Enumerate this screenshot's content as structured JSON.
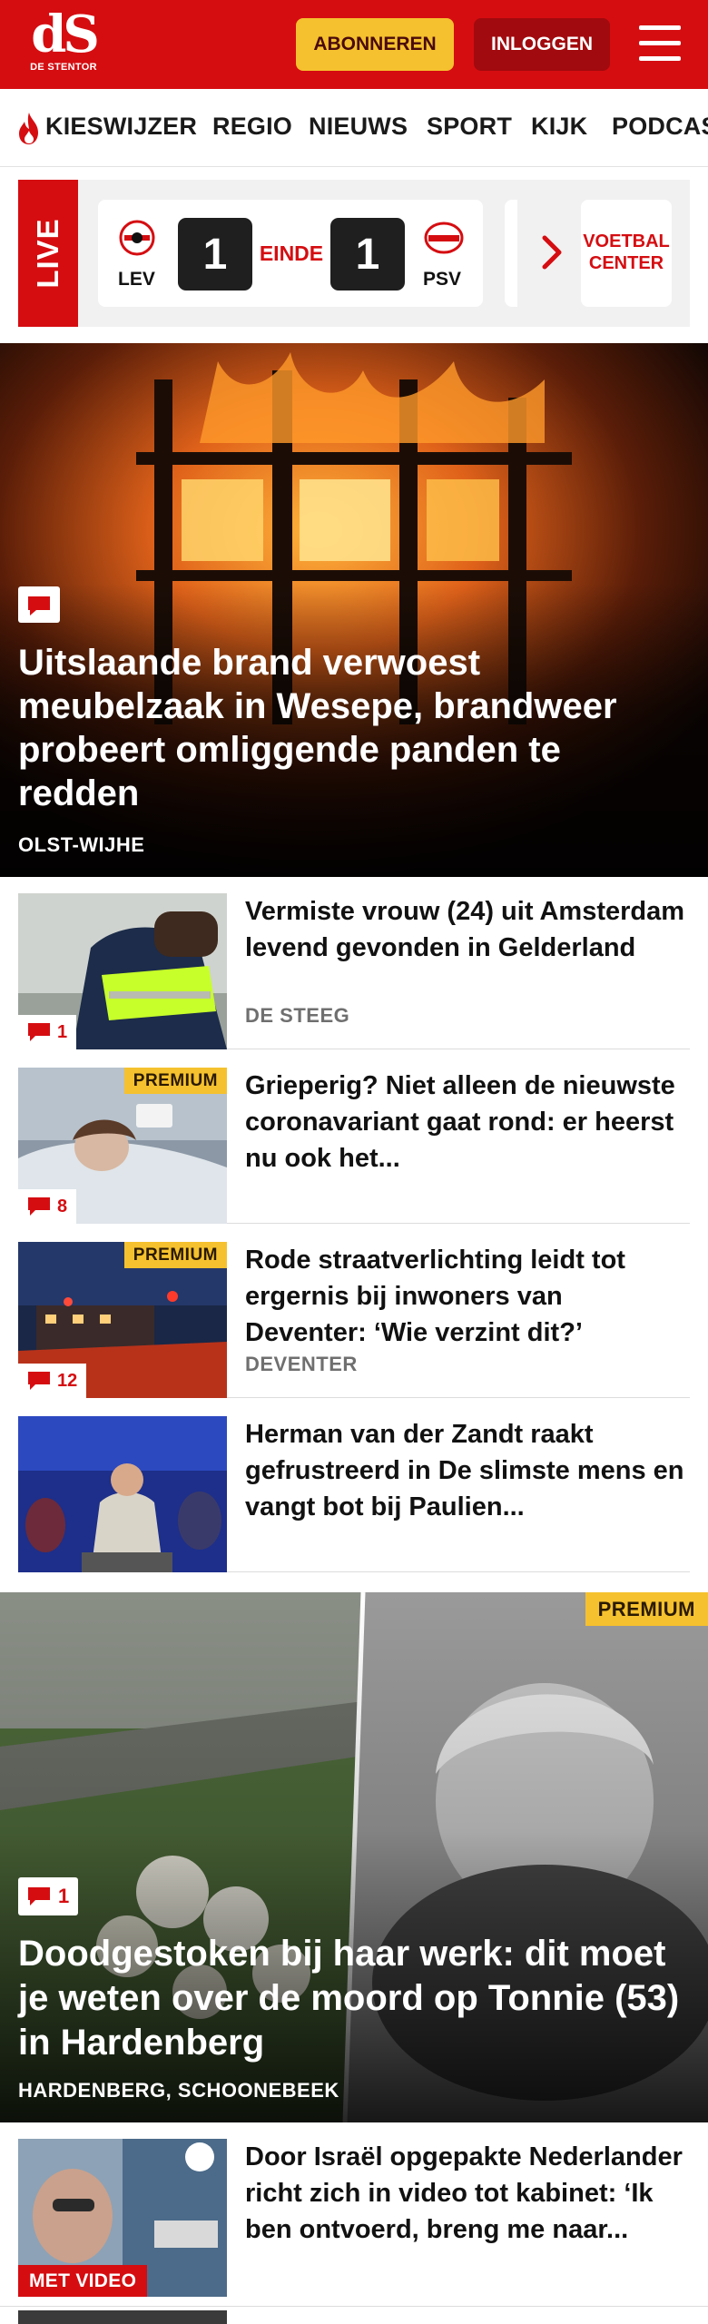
{
  "header": {
    "logo_mark": "dS",
    "logo_name": "DE STENTOR",
    "subscribe_label": "ABONNEREN",
    "login_label": "INLOGGEN"
  },
  "nav": {
    "items": [
      "KIESWIJZER",
      "REGIO",
      "NIEUWS",
      "SPORT",
      "KIJK",
      "PODCAST"
    ]
  },
  "live": {
    "tag": "LIVE",
    "home_team": "LEV",
    "home_score": "1",
    "status": "EINDE",
    "away_score": "1",
    "away_team": "PSV",
    "away_logo_text": "PSV",
    "voetbal_line1": "VOETBAL",
    "voetbal_line2": "CENTER"
  },
  "hero": {
    "title": "Uitslaande brand verwoest meubelzaak in Wesepe, brandweer probeert omliggende panden te redden",
    "location": "OLST-WIJHE"
  },
  "articles": [
    {
      "title": "Vermiste vrouw (24) uit Amsterdam levend gevonden in Gelderland",
      "location": "DE STEEG",
      "comments": "1",
      "premium": ""
    },
    {
      "title": "Grieperig? Niet alleen de nieuwste coronavariant gaat rond: er heerst nu ook het...",
      "location": "",
      "comments": "8",
      "premium": "PREMIUM"
    },
    {
      "title": "Rode straatverlichting leidt tot ergernis bij inwoners van Deventer: ‘Wie verzint dit?’",
      "location": "DEVENTER",
      "comments": "12",
      "premium": "PREMIUM"
    },
    {
      "title": "Herman van der Zandt raakt gefrustreerd in De slimste mens en vangt bot bij Paulien...",
      "location": "",
      "comments": "",
      "premium": ""
    }
  ],
  "feature": {
    "premium": "PREMIUM",
    "comments": "1",
    "title": "Doodgestoken bij haar werk: dit moet je weten over de moord op Tonnie (53) in Hardenberg",
    "location": "HARDENBERG, SCHOONEBEEK"
  },
  "article_video": {
    "title": "Door Israël opgepakte Nederlander richt zich in video tot kabinet: ‘Ik ben ontvoerd, breng me naar...",
    "badge": "MET VIDEO"
  },
  "colors": {
    "brand_red": "#d50d11",
    "premium_yellow": "#f5c12e",
    "dark_red": "#a10a0e"
  }
}
